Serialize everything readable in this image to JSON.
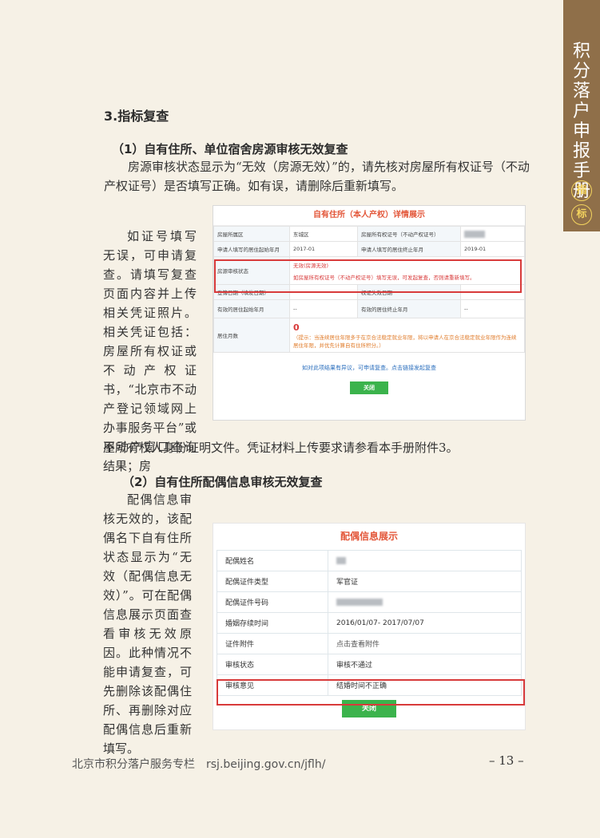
{
  "sidebar": {
    "title": "积分落户申报手册",
    "badge1": "指",
    "badge2": "标"
  },
  "section": {
    "title": "3.指标复查"
  },
  "sub1": {
    "title": "（1）自有住所、单位宿舍房源审核无效复查",
    "intro": "房源审核状态显示为“无效（房源无效）”的，请先核对房屋所有权证号（不动产权证号）是否填写正确。如有误，请删除后重新填写。",
    "side_text": "如证号填写无误，可申请复查。请填写复查页面内容并上传相关凭证照片。相关凭证包括：房屋所有权证或不动产权证书，“北京市不动产登记领域网上办事服务平台”或不动产窗口查询结果；房",
    "continued": "屋所有权人身份证明文件。凭证材料上传要求请参看本手册附件3。"
  },
  "panel1": {
    "title": "自有住所（本人产权）详情展示",
    "row1": {
      "l1": "房屋所属区",
      "v1": "东城区",
      "l2": "房屋所有权证号（不动产权证号）"
    },
    "row2": {
      "l1": "申请人填写的居住起始年月",
      "v1": "2017-01",
      "l2": "申请人填写的居住终止年月",
      "v2": "2019-01"
    },
    "row3": {
      "l1": "房源审核状态",
      "v1a": "无效(房源无效)",
      "v1b": "如房屋所有权证号（不动产权证号）填写无误，可发起复查，否则请重新填写。"
    },
    "row4": {
      "l1": "登簿日期（填发日期）",
      "v1": "--",
      "l2": "权证失效日期",
      "v2": "--"
    },
    "row5": {
      "l1": "有效的居住起始年月",
      "v1": "--",
      "l2": "有效的居住终止年月",
      "v2": "--"
    },
    "row6": {
      "l1": "居住月数",
      "v1": "0",
      "note": "（提示：当连续居住年限多于在京合法稳定就业年限，将以申请人在京合法稳定就业年限作为连续居住年限，并优先计算自有住所积分。）"
    },
    "link": "如对此项结果有异议，可申请复查。点击链接发起复查",
    "close": "关闭"
  },
  "sub2": {
    "title": "（2）自有住所配偶信息审核无效复查",
    "side_text": "配偶信息审核无效的，该配偶名下自有住所状态显示为“无效（配偶信息无效）”。可在配偶信息展示页面查看审核无效原因。此种情况不能申请复查，可先删除该配偶住所、再删除对应配偶信息后重新填写。"
  },
  "panel2": {
    "title": "配偶信息展示",
    "rows": [
      {
        "label": "配偶姓名",
        "value": ""
      },
      {
        "label": "配偶证件类型",
        "value": "军官证"
      },
      {
        "label": "配偶证件号码",
        "value": ""
      },
      {
        "label": "婚姻存续时间",
        "value": "2016/01/07- 2017/07/07"
      },
      {
        "label": "证件附件",
        "value": "点击查看附件"
      },
      {
        "label": "审核状态",
        "value": "审核不通过"
      },
      {
        "label": "审核意见",
        "value": "结婚时间不正确"
      }
    ],
    "close": "关闭"
  },
  "footer": {
    "text": "北京市积分落户服务专栏　rsj.beijing.gov.cn/jflh/",
    "page": "– 13 –"
  },
  "colors": {
    "accent_red": "#d83a3a",
    "button_green": "#3bb34c",
    "tab_brown": "#8f6f49"
  }
}
